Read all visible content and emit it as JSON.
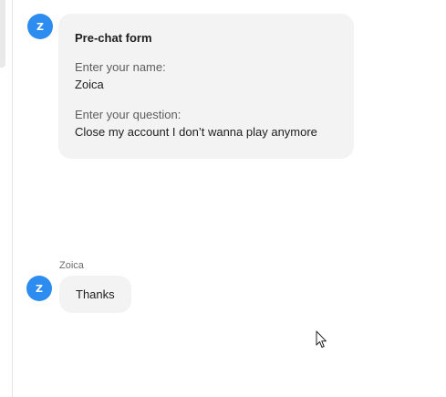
{
  "conversation": {
    "form_message": {
      "avatar_initial": "Z",
      "title": "Pre-chat form",
      "fields": [
        {
          "label": "Enter your name:",
          "value": "Zoica"
        },
        {
          "label": "Enter your question:",
          "value": "Close my account I don’t wanna play anymore"
        }
      ]
    },
    "chat_message": {
      "sender": "Zoica",
      "avatar_initial": "Z",
      "text": "Thanks"
    }
  },
  "colors": {
    "avatar_bg": "#2d8cf0",
    "bubble_bg": "#f3f3f3"
  },
  "icons": {
    "cursor": "mouse-pointer-icon"
  }
}
